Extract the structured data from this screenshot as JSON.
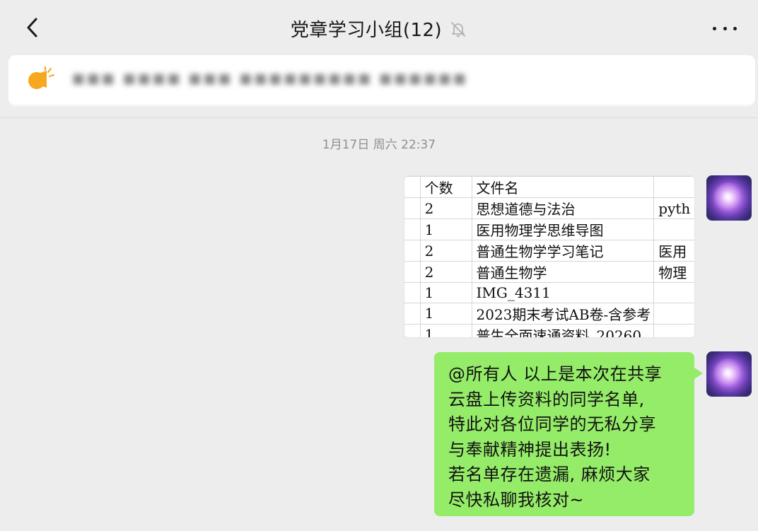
{
  "header": {
    "title": "党章学习小组(12)",
    "back_icon": "chevron-left-icon",
    "mute_icon": "bell-off-icon",
    "more_icon": "more-horizontal-icon"
  },
  "notice": {
    "icon": "megaphone-icon",
    "icon_color": "#f6a821",
    "text": "■■■ ■■■■ ■■■ ■■■■■■■■■ ■■■■■■"
  },
  "timestamp": "1月17日 周六 22:37",
  "messages": [
    {
      "type": "image",
      "table": {
        "header": [
          "",
          "个数",
          "文件名",
          ""
        ],
        "rows": [
          [
            "",
            "2",
            "思想道德与法治",
            "pyth"
          ],
          [
            "",
            "1",
            "医用物理学思维导图",
            ""
          ],
          [
            "",
            "2",
            "普通生物学学习笔记",
            "医用"
          ],
          [
            "",
            "2",
            "普通生物学",
            "物理"
          ],
          [
            "",
            "1",
            "IMG_4311",
            ""
          ],
          [
            "",
            "1",
            "2023期末考试AB卷-含参考",
            ""
          ],
          [
            "",
            "1",
            "普生全面速通资料_20260",
            ""
          ]
        ]
      }
    },
    {
      "type": "text",
      "bubble_color": "#95ec69",
      "lines": [
        "@所有人  以上是本次在共享",
        "云盘上传资料的同学名单,",
        "特此对各位同学的无私分享",
        "与奉献精神提出表扬!",
        "若名单存在遗漏, 麻烦大家",
        "尽快私聊我核对~"
      ]
    }
  ]
}
